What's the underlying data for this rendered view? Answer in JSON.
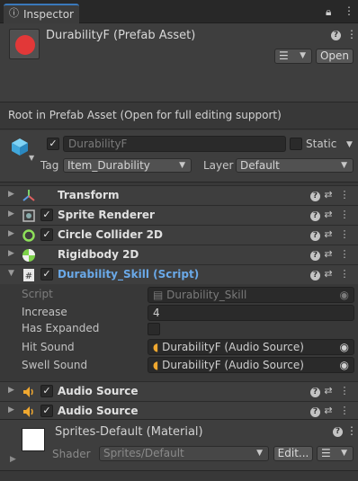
{
  "window": {
    "tab_label": "Inspector",
    "tab_icon": "info-icon"
  },
  "asset": {
    "title": "DurabilityF (Prefab Asset)",
    "open_label": "Open",
    "color": "#e23838"
  },
  "root_notice": "Root in Prefab Asset (Open for full editing support)",
  "gameobject": {
    "name": "DurabilityF",
    "static_label": "Static",
    "tag_label": "Tag",
    "tag_value": "Item_Durability",
    "layer_label": "Layer",
    "layer_value": "Default"
  },
  "components": [
    {
      "name": "Transform",
      "icon": "transform-icon",
      "has_checkbox": false
    },
    {
      "name": "Sprite Renderer",
      "icon": "sprite-renderer-icon",
      "has_checkbox": true
    },
    {
      "name": "Circle Collider 2D",
      "icon": "circle-collider-icon",
      "has_checkbox": true
    },
    {
      "name": "Rigidbody 2D",
      "icon": "rigidbody-icon",
      "has_checkbox": false
    },
    {
      "name": "Durability_Skill (Script)",
      "icon": "script-icon",
      "has_checkbox": true
    },
    {
      "name": "Audio Source",
      "icon": "audio-source-icon",
      "has_checkbox": true
    },
    {
      "name": "Audio Source",
      "icon": "audio-source-icon",
      "has_checkbox": true
    }
  ],
  "script_props": {
    "script_label": "Script",
    "script_value": "Durability_Skill",
    "increase_label": "Increase",
    "increase_value": "4",
    "has_expanded_label": "Has Expanded",
    "hit_sound_label": "Hit Sound",
    "hit_sound_value": "DurabilityF (Audio Source)",
    "swell_sound_label": "Swell Sound",
    "swell_sound_value": "DurabilityF (Audio Source)"
  },
  "material": {
    "name": "Sprites-Default (Material)",
    "shader_label": "Shader",
    "shader_value": "Sprites/Default",
    "edit_label": "Edit..."
  },
  "colors": {
    "accent": "#3a79bb",
    "script_name": "#6aa9e8",
    "panel": "#383838"
  }
}
